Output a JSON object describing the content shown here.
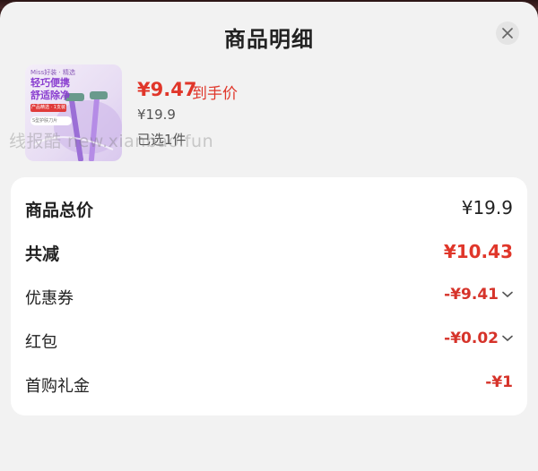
{
  "sheet": {
    "title": "商品明细",
    "close_icon": "close-icon"
  },
  "product": {
    "image_brand_tag": "Miss好装 · 精选",
    "image_slogan": "轻巧便携\n舒适除净",
    "image_chip1": "产品精选 · 1支装",
    "image_chip2": "S型护肤刀片",
    "price_now": "¥9.47",
    "price_now_label": "到手价",
    "price_original": "¥19.9",
    "selected_text": "已选1件"
  },
  "watermark": "线报酷 new.xianbao.fun",
  "breakdown": {
    "total_label": "商品总价",
    "total_value": "¥19.9",
    "reduce_label": "共减",
    "reduce_value": "¥10.43",
    "coupon_label": "优惠券",
    "coupon_value": "-¥9.41",
    "redpacket_label": "红包",
    "redpacket_value": "-¥0.02",
    "firstbuy_label": "首购礼金",
    "firstbuy_value": "-¥1"
  },
  "colors": {
    "accent_red": "#e0362a",
    "sheet_bg": "#f2f2f2",
    "card_bg": "#ffffff"
  }
}
